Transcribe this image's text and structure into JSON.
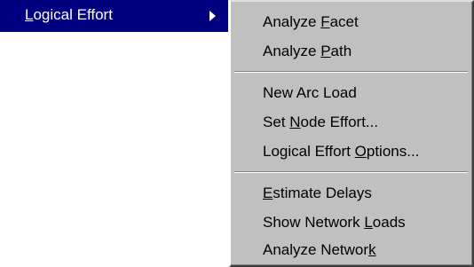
{
  "parent": {
    "label_prefix": "",
    "label_key": "L",
    "label_rest": "ogical Effort",
    "arrow_icon": "submenu-arrow-right"
  },
  "colors": {
    "highlight": "#000080",
    "menu_face": "#c0c0c0",
    "shadow": "#808080",
    "highlight_edge": "#ffffff"
  },
  "submenu": {
    "items": [
      {
        "prefix": "Analyze ",
        "key": "F",
        "rest": "acet"
      },
      {
        "prefix": "Analyze ",
        "key": "P",
        "rest": "ath"
      },
      {
        "prefix": "New Arc Load",
        "key": "",
        "rest": ""
      },
      {
        "prefix": "Set ",
        "key": "N",
        "rest": "ode Effort..."
      },
      {
        "prefix": "Logical Effort ",
        "key": "O",
        "rest": "ptions..."
      },
      {
        "prefix": "",
        "key": "E",
        "rest": "stimate Delays"
      },
      {
        "prefix": "Show Network ",
        "key": "L",
        "rest": "oads"
      },
      {
        "prefix": "Analyze Networ",
        "key": "k",
        "rest": ""
      }
    ]
  }
}
